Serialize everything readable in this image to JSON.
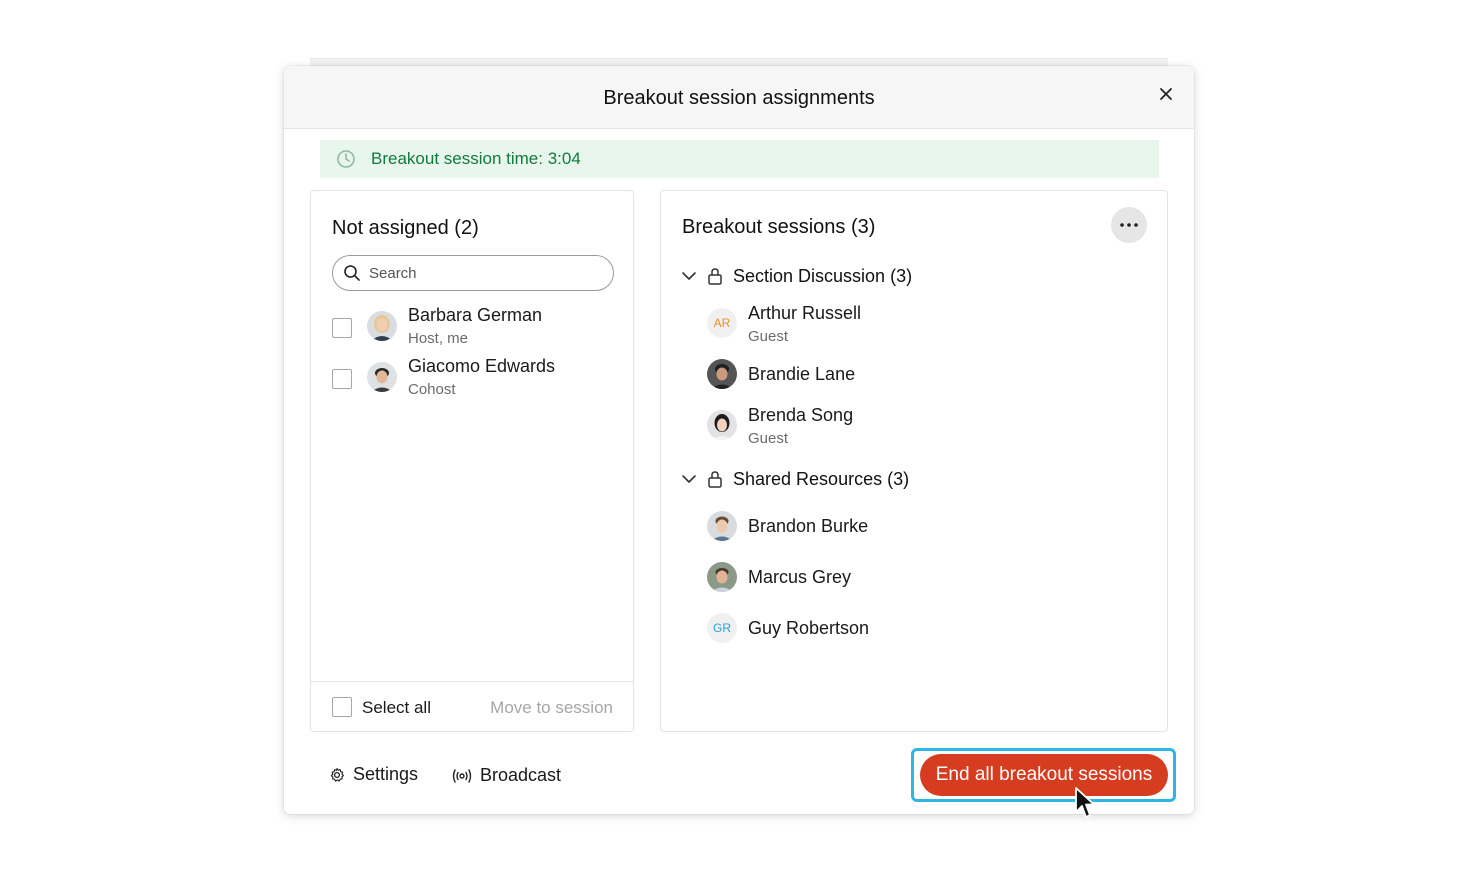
{
  "dialog": {
    "title": "Breakout session assignments",
    "close_icon": "close-icon"
  },
  "timer": {
    "icon": "clock-icon",
    "text": "Breakout session time: 3:04",
    "color": "#127a3b",
    "background": "#e8f6ee"
  },
  "not_assigned": {
    "heading": "Not assigned (2)",
    "search_placeholder": "Search",
    "people": [
      {
        "name": "Barbara German",
        "role": "Host, me"
      },
      {
        "name": "Giacomo Edwards",
        "role": "Cohost"
      }
    ],
    "select_all_label": "Select all",
    "move_label": "Move to session"
  },
  "breakout": {
    "heading": "Breakout sessions (3)",
    "more_icon": "more-horizontal-icon",
    "groups": [
      {
        "name": "Section Discussion (3)",
        "members": [
          {
            "name": "Arthur Russell",
            "role": "Guest",
            "initials": "AR",
            "initials_color": "#e8902a"
          },
          {
            "name": "Brandie Lane",
            "role": ""
          },
          {
            "name": "Brenda Song",
            "role": "Guest"
          }
        ]
      },
      {
        "name": "Shared Resources (3)",
        "members": [
          {
            "name": "Brandon Burke",
            "role": ""
          },
          {
            "name": "Marcus Grey",
            "role": ""
          },
          {
            "name": "Guy Robertson",
            "role": "",
            "initials": "GR",
            "initials_color": "#2a9fd8"
          }
        ]
      }
    ]
  },
  "footer": {
    "settings_label": "Settings",
    "broadcast_label": "Broadcast",
    "end_label": "End all breakout sessions",
    "end_color": "#d63c1f",
    "focus_color": "#2fb6e6"
  }
}
